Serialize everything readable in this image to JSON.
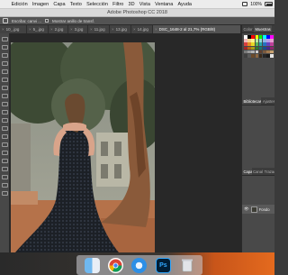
{
  "menubar": {
    "apple_glyph": "",
    "items": [
      "Edición",
      "Imagen",
      "Capa",
      "Texto",
      "Selección",
      "Filtro",
      "3D",
      "Vista",
      "Ventana",
      "Ayuda"
    ],
    "battery_pct": "100%"
  },
  "window": {
    "title": "Adobe Photoshop CC 2018"
  },
  "options": {
    "label": "Escriba: canvi ...",
    "checkbox_label": "Mostrar anillo de transf."
  },
  "tabs": [
    {
      "label": "10_.jpg",
      "active": false
    },
    {
      "label": "5_.jpg",
      "active": false
    },
    {
      "label": "2.jpg",
      "active": false
    },
    {
      "label": "3.jpg",
      "active": false
    },
    {
      "label": "11.jpg",
      "active": false
    },
    {
      "label": "13.jpg",
      "active": false
    },
    {
      "label": "14.jpg",
      "active": false
    },
    {
      "label": "DSC_1648-2 al 21,7% (RGB/8)",
      "active": true
    }
  ],
  "panels": {
    "top_tabs": [
      "Color",
      "Muestras"
    ],
    "mid_tabs": [
      "Bibliotecas",
      "Ajustes"
    ],
    "layers_tabs": [
      "Capas",
      "Canales",
      "Trazados"
    ],
    "layer_name": "Fondo"
  },
  "dock": {
    "ps_label": "Ps"
  },
  "colors": {
    "accent_ps": "#31a8ff",
    "ps_bg": "#001e36",
    "dress": "#1c2026",
    "ground": "#b5724a"
  },
  "swatch_colors": [
    "#ffffff",
    "#000000",
    "#ff0000",
    "#ffff00",
    "#00ff00",
    "#00ffff",
    "#0000ff",
    "#ff00ff",
    "#f2b8b8",
    "#f5d28c",
    "#fff28c",
    "#b8e69a",
    "#8cd9d9",
    "#8cb3e6",
    "#b89ae6",
    "#e69ad0",
    "#d94040",
    "#e68c26",
    "#e6d926",
    "#59b359",
    "#26a6a6",
    "#2673bf",
    "#6640bf",
    "#bf4099",
    "#a62626",
    "#b36619",
    "#a69c1a",
    "#2d7f2d",
    "#1a7373",
    "#1a4c8c",
    "#4c268c",
    "#8c266b",
    "#7a7a7a",
    "#999999",
    "#b3b3b3",
    "#cccccc",
    "#5e4030",
    "#7a5a40",
    "#a07850",
    "#c8a070",
    "#404040",
    "#595959",
    "#6b4a2a",
    "#8c6640",
    "#3a2a1a",
    "#262626",
    "#1a1a1a",
    "#e6e6e6"
  ]
}
